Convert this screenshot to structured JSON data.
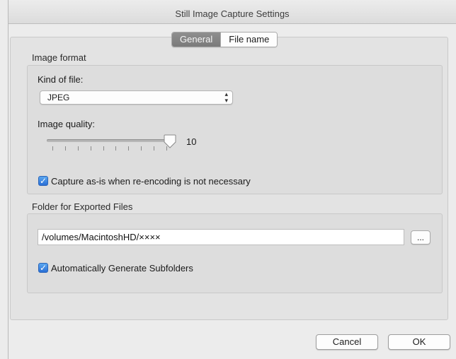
{
  "window": {
    "title": "Still Image Capture Settings"
  },
  "tabs": [
    {
      "label": "General",
      "active": true
    },
    {
      "label": "File name",
      "active": false
    }
  ],
  "image_format": {
    "section_label": "Image format",
    "kind_of_file_label": "Kind of file:",
    "kind_of_file_value": "JPEG",
    "image_quality_label": "Image quality:",
    "image_quality_value": "10",
    "image_quality_fraction": 1.0,
    "capture_as_is_label": "Capture as-is when re-encoding is not necessary",
    "capture_as_is_checked": true
  },
  "folder": {
    "section_label": "Folder for Exported Files",
    "path_value": "/volumes/MacintoshHD/××××",
    "browse_label": "...",
    "auto_subfolders_label": "Automatically Generate Subfolders",
    "auto_subfolders_checked": true
  },
  "buttons": {
    "cancel": "Cancel",
    "ok": "OK"
  },
  "colors": {
    "checkbox_accent": "#2a6fd6",
    "active_tab": "#838383"
  },
  "icons": {
    "checkbox": "checkmark-icon",
    "popup_arrows": "up-down-arrows-icon",
    "slider_knob": "slider-knob-icon"
  }
}
